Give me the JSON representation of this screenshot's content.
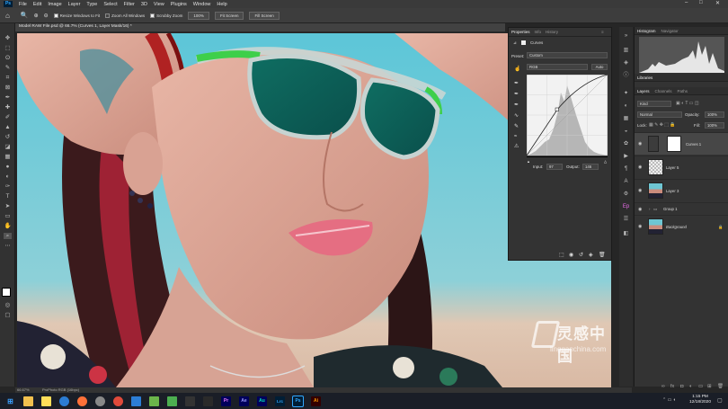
{
  "menu": {
    "app_logo": "Ps",
    "items": [
      "File",
      "Edit",
      "Image",
      "Layer",
      "Type",
      "Select",
      "Filter",
      "3D",
      "View",
      "Plugins",
      "Window",
      "Help"
    ],
    "window_controls": [
      "–",
      "□",
      "✕"
    ]
  },
  "options_bar": {
    "resize_windows_label": "Resize Windows to Fit",
    "zoom_all_label": "Zoom All Windows",
    "scrubby_zoom_label": "Scrubby Zoom",
    "zoom_100_label": "100%",
    "fit_screen_label": "Fit Screen",
    "fill_screen_label": "Fill Screen"
  },
  "document": {
    "tab_title": "Model RAW File.psd @ 66.7% (Curves 1, Layer Mask/16) *",
    "zoom_status": "66.67%",
    "status_text": "ProPhoto RGB (16bpc)"
  },
  "properties": {
    "tabs": [
      "Properties",
      "Info",
      "History"
    ],
    "active_tab": "Properties",
    "panel_label": "Curves",
    "preset_label": "Preset:",
    "preset_value": "Custom",
    "channel_value": "RGB",
    "auto_button": "Auto",
    "input_label": "Input:",
    "input_value": "97",
    "output_label": "Output:",
    "output_value": "146"
  },
  "histogram": {
    "tabs": [
      "Histogram",
      "Navigator"
    ],
    "active_tab": "Histogram"
  },
  "libraries": {
    "title": "Libraries"
  },
  "layers_panel": {
    "tabs": [
      "Layers",
      "Channels",
      "Paths"
    ],
    "active_tab": "Layers",
    "filter_kind": "Kind",
    "blend_mode": "Normal",
    "opacity_label": "Opacity:",
    "opacity_value": "100%",
    "lock_label": "Lock:",
    "fill_label": "Fill:",
    "fill_value": "100%",
    "layers": [
      {
        "name": "Curves 1",
        "type": "adjustment"
      },
      {
        "name": "Layer 5",
        "type": "transparent"
      },
      {
        "name": "Layer 3",
        "type": "photo"
      },
      {
        "name": "Group 1",
        "type": "group"
      },
      {
        "name": "Background",
        "type": "photo"
      }
    ]
  },
  "watermark": {
    "chinese": "灵感中国",
    "url": "lingganchina.com"
  },
  "taskbar": {
    "time": "1:15 PM",
    "date": "12/18/2020",
    "apps": [
      "Pr",
      "Ae",
      "Au",
      "Lrc",
      "Ps",
      "Ai"
    ]
  },
  "colors": {
    "ps_blue": "#31a8ff",
    "panel_bg": "#333333",
    "canvas_sky": "#6ec6d3"
  }
}
